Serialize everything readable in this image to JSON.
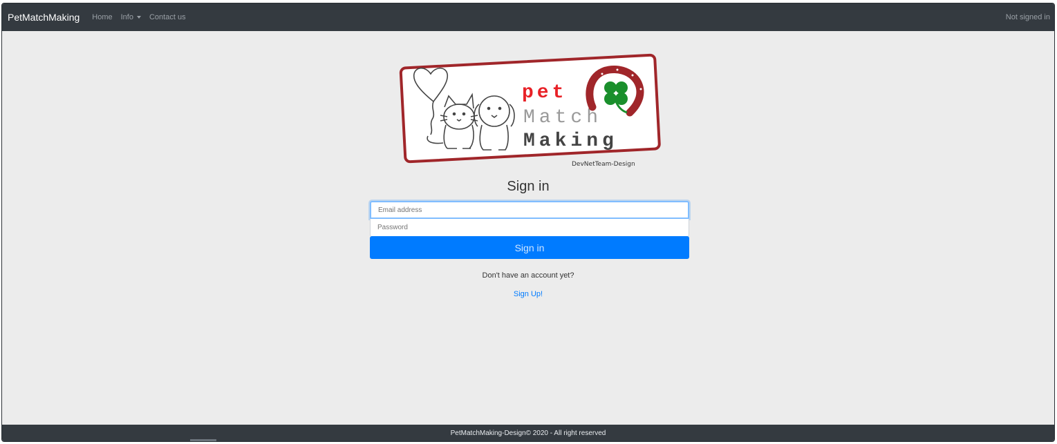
{
  "navbar": {
    "brand": "PetMatchMaking",
    "links": {
      "home": "Home",
      "info": "Info",
      "contact": "Contact us"
    },
    "status": "Not signed in"
  },
  "logo": {
    "line1": "pet",
    "line2": "Match",
    "line3": "Making",
    "credit": "DevNetTeam-Design"
  },
  "signin": {
    "title": "Sign in",
    "email_placeholder": "Email address",
    "password_placeholder": "Password",
    "button_label": "Sign in",
    "no_account_text": "Don't have an account yet?",
    "signup_label": "Sign Up!"
  },
  "footer": {
    "text": "PetMatchMaking-Design© 2020 - All right reserved"
  },
  "colors": {
    "navbar": "#343a40",
    "primary": "#007bff",
    "logo_red": "#e82127",
    "logo_border": "#a0262a",
    "clover_green": "#1a8f2c"
  },
  "icons": {
    "dropdown": "caret-down-icon",
    "logo_balloon": "heart-balloon-icon",
    "logo_clover": "four-leaf-clover-icon",
    "logo_horseshoe": "horseshoe-icon"
  }
}
